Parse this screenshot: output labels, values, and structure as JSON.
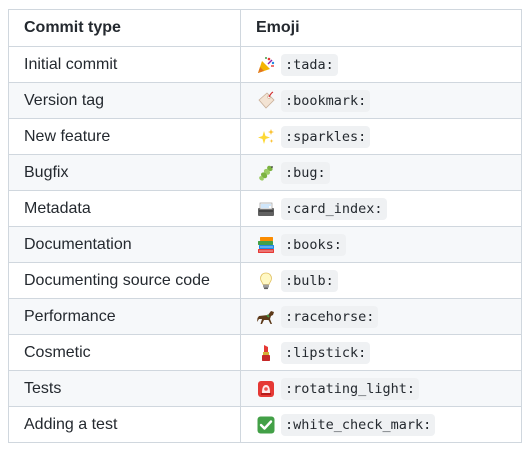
{
  "table": {
    "headers": {
      "commit_type": "Commit type",
      "emoji": "Emoji"
    },
    "rows": [
      {
        "type": "Initial commit",
        "code": ":tada:",
        "icon": "party-popper-icon"
      },
      {
        "type": "Version tag",
        "code": ":bookmark:",
        "icon": "bookmark-tag-icon"
      },
      {
        "type": "New feature",
        "code": ":sparkles:",
        "icon": "sparkles-icon"
      },
      {
        "type": "Bugfix",
        "code": ":bug:",
        "icon": "bug-icon"
      },
      {
        "type": "Metadata",
        "code": ":card_index:",
        "icon": "card-index-icon"
      },
      {
        "type": "Documentation",
        "code": ":books:",
        "icon": "books-icon"
      },
      {
        "type": "Documenting source code",
        "code": ":bulb:",
        "icon": "light-bulb-icon"
      },
      {
        "type": "Performance",
        "code": ":racehorse:",
        "icon": "racehorse-icon"
      },
      {
        "type": "Cosmetic",
        "code": ":lipstick:",
        "icon": "lipstick-icon"
      },
      {
        "type": "Tests",
        "code": ":rotating_light:",
        "icon": "rotating-light-icon"
      },
      {
        "type": "Adding a test",
        "code": ":white_check_mark:",
        "icon": "white-check-mark-icon"
      }
    ]
  }
}
